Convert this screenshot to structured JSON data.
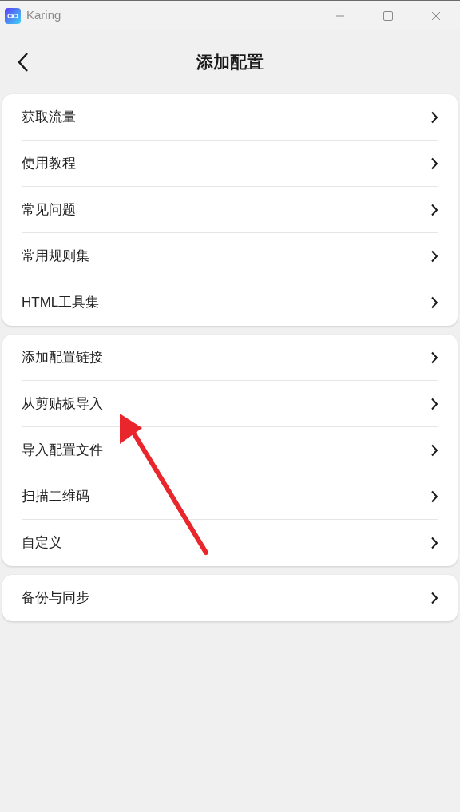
{
  "window": {
    "title": "Karing"
  },
  "header": {
    "title": "添加配置"
  },
  "groups": [
    {
      "items": [
        {
          "label": "获取流量"
        },
        {
          "label": "使用教程"
        },
        {
          "label": "常见问题"
        },
        {
          "label": "常用规则集"
        },
        {
          "label": "HTML工具集"
        }
      ]
    },
    {
      "items": [
        {
          "label": "添加配置链接"
        },
        {
          "label": "从剪贴板导入"
        },
        {
          "label": "导入配置文件"
        },
        {
          "label": "扫描二维码"
        },
        {
          "label": "自定义"
        }
      ]
    },
    {
      "items": [
        {
          "label": "备份与同步"
        }
      ]
    }
  ]
}
